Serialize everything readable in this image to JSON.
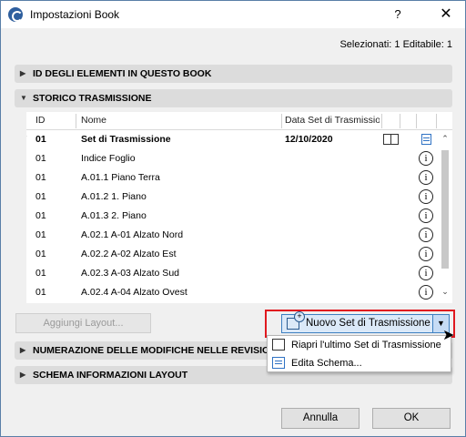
{
  "window": {
    "title": "Impostazioni Book",
    "help_label": "?",
    "close_label": "✕"
  },
  "selection_info": "Selezionati: 1 Editabile: 1",
  "sections": {
    "ids": "ID DEGLI ELEMENTI IN QUESTO BOOK",
    "history": "STORICO TRASMISSIONE",
    "numbering": "NUMERAZIONE DELLE MODIFICHE NELLE REVISIO",
    "schema": "SCHEMA INFORMAZIONI LAYOUT"
  },
  "table": {
    "headers": {
      "id": "ID",
      "name": "Nome",
      "date": "Data Set di Trasmissio"
    },
    "set_row": {
      "id": "01",
      "name": "Set di Trasmissione",
      "date": "12/10/2020"
    },
    "rows": [
      {
        "id": "01",
        "name": "Indice Foglio"
      },
      {
        "id": "01",
        "name": "A.01.1 Piano Terra"
      },
      {
        "id": "01",
        "name": "A.01.2 1. Piano"
      },
      {
        "id": "01",
        "name": "A.01.3 2. Piano"
      },
      {
        "id": "01",
        "name": "A.02.1 A-01 Alzato Nord"
      },
      {
        "id": "01",
        "name": "A.02.2 A-02 Alzato Est"
      },
      {
        "id": "01",
        "name": "A.02.3 A-03 Alzato Sud"
      },
      {
        "id": "01",
        "name": "A.02.4 A-04 Alzato Ovest"
      }
    ],
    "info_glyph": "i"
  },
  "buttons": {
    "add_layout": "Aggiungi Layout...",
    "new_set": "Nuovo Set di Trasmissione",
    "cancel": "Annulla",
    "ok": "OK"
  },
  "menu": {
    "reopen": "Riapri l'ultimo Set di Trasmissione",
    "edit_schema": "Edita Schema..."
  },
  "colors": {
    "highlight_border": "#e0191f",
    "accent": "#3c7fc1"
  }
}
